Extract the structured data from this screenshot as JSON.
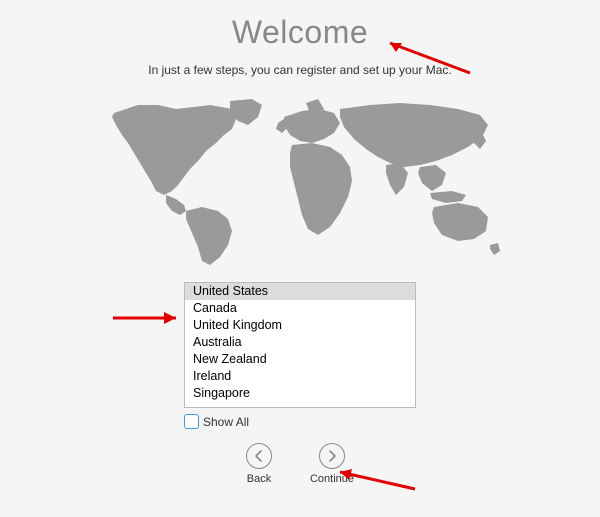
{
  "title": "Welcome",
  "subtitle": "In just a few steps, you can register and set up your Mac.",
  "countries": [
    "United States",
    "Canada",
    "United Kingdom",
    "Australia",
    "New Zealand",
    "Ireland",
    "Singapore"
  ],
  "selected_index": 0,
  "show_all_label": "Show All",
  "buttons": {
    "back": "Back",
    "continue": "Continue"
  }
}
